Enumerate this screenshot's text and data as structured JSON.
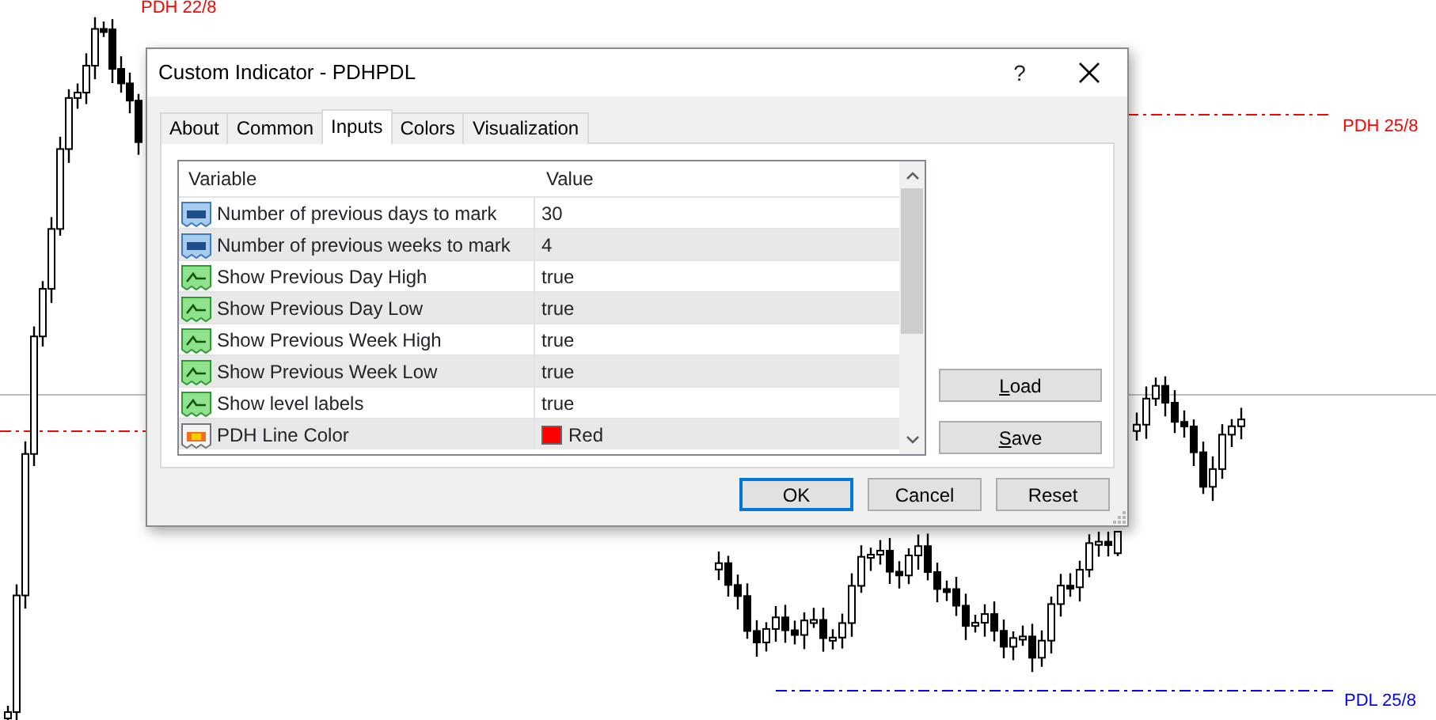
{
  "chart": {
    "level_labels": [
      {
        "text": "PDH 22/8",
        "color": "#ff0000"
      },
      {
        "text": "PDH 25/8",
        "color": "#ff0000"
      },
      {
        "text": "PDL 25/8",
        "color": "#0000ff"
      }
    ]
  },
  "dialog": {
    "title": "Custom Indicator - PDHPDL",
    "help": "?",
    "tabs": [
      {
        "label": "About",
        "selected": false
      },
      {
        "label": "Common",
        "selected": false
      },
      {
        "label": "Inputs",
        "selected": true
      },
      {
        "label": "Colors",
        "selected": false
      },
      {
        "label": "Visualization",
        "selected": false
      }
    ],
    "table": {
      "columns": [
        "Variable",
        "Value"
      ],
      "rows": [
        {
          "kind": "number",
          "variable": "Number of previous days to mark",
          "value": "30"
        },
        {
          "kind": "number",
          "variable": "Number of previous weeks to mark",
          "value": "4"
        },
        {
          "kind": "bool",
          "variable": "Show Previous Day High",
          "value": "true"
        },
        {
          "kind": "bool",
          "variable": "Show Previous Day Low",
          "value": "true"
        },
        {
          "kind": "bool",
          "variable": "Show Previous Week High",
          "value": "true"
        },
        {
          "kind": "bool",
          "variable": "Show Previous Week Low",
          "value": "true"
        },
        {
          "kind": "bool",
          "variable": "Show level labels",
          "value": "true"
        },
        {
          "kind": "color",
          "variable": "PDH Line Color",
          "value": "Red",
          "color": "#ff0000"
        }
      ]
    },
    "side_buttons": [
      "Load",
      "Save"
    ],
    "buttons": [
      {
        "label": "OK",
        "default": true
      },
      {
        "label": "Cancel",
        "default": false
      },
      {
        "label": "Reset",
        "default": false
      }
    ]
  }
}
